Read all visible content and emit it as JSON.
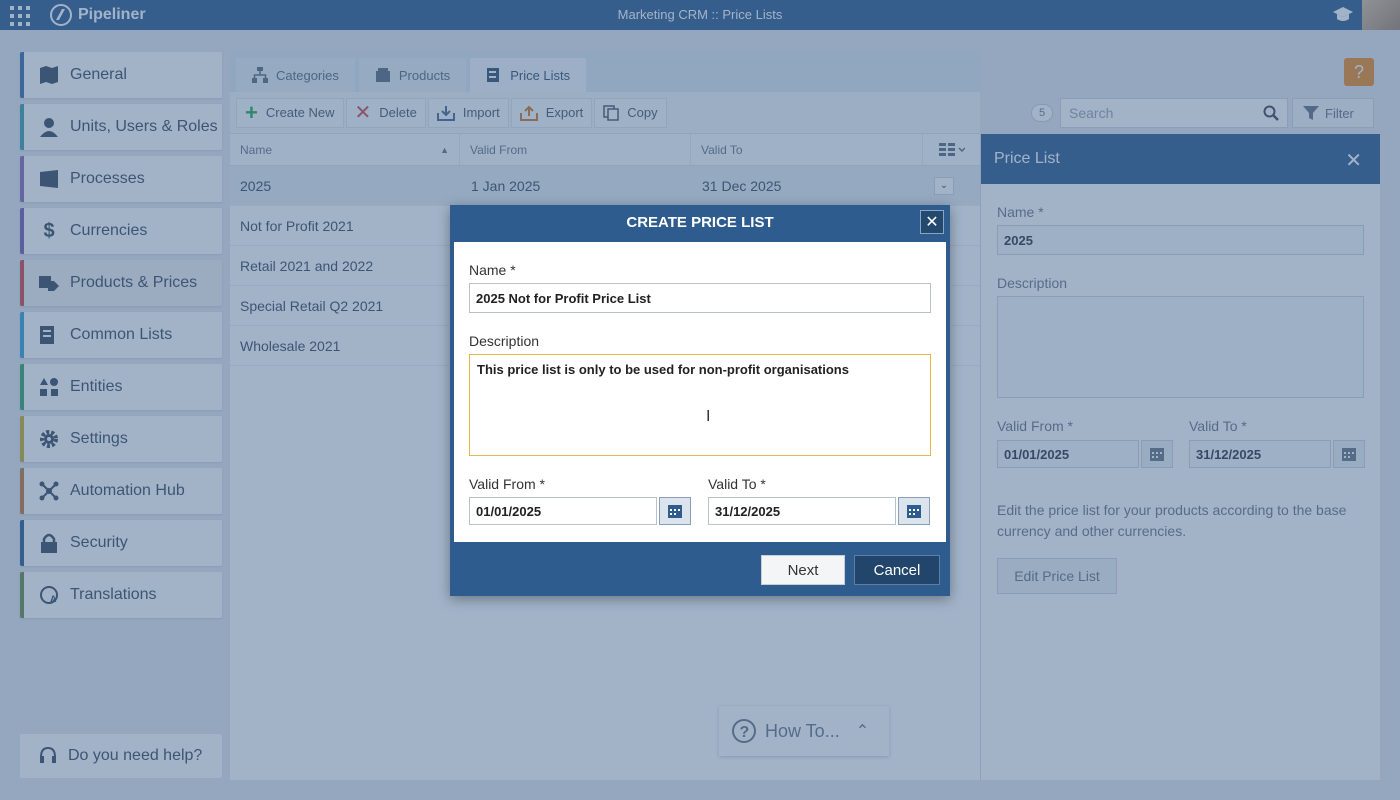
{
  "app": {
    "name": "Pipeliner",
    "window_title": "Marketing CRM :: Price Lists"
  },
  "nav": {
    "items": [
      {
        "label": "General",
        "color": "#3a6ea8"
      },
      {
        "label": "Units, Users & Roles",
        "color": "#40a0b0"
      },
      {
        "label": "Processes",
        "color": "#8a6bb5"
      },
      {
        "label": "Currencies",
        "color": "#7c5cb5"
      },
      {
        "label": "Products & Prices",
        "color": "#d2474a"
      },
      {
        "label": "Common Lists",
        "color": "#3aa2d8"
      },
      {
        "label": "Entities",
        "color": "#37a46a"
      },
      {
        "label": "Settings",
        "color": "#c8b02a"
      },
      {
        "label": "Automation Hub",
        "color": "#c47a39"
      },
      {
        "label": "Security",
        "color": "#2d5d94"
      },
      {
        "label": "Translations",
        "color": "#6b8c4b"
      }
    ],
    "help_label": "Do you need help?"
  },
  "tabs": [
    {
      "label": "Categories"
    },
    {
      "label": "Products"
    },
    {
      "label": "Price Lists"
    }
  ],
  "toolbar": {
    "create": "Create New",
    "delete": "Delete",
    "import": "Import",
    "export": "Export",
    "copy": "Copy",
    "count": "5",
    "search_placeholder": "Search",
    "filter": "Filter"
  },
  "grid": {
    "columns": [
      "Name",
      "Valid From",
      "Valid To"
    ],
    "rows": [
      {
        "name": "2025",
        "from": "1 Jan 2025",
        "to": "31 Dec 2025"
      },
      {
        "name": "Not for Profit 2021",
        "from": "",
        "to": ""
      },
      {
        "name": "Retail 2021 and 2022",
        "from": "",
        "to": ""
      },
      {
        "name": "Special Retail Q2 2021",
        "from": "",
        "to": ""
      },
      {
        "name": "Wholesale 2021",
        "from": "",
        "to": ""
      }
    ]
  },
  "side_panel": {
    "title": "Price List",
    "name_label": "Name *",
    "name_value": "2025",
    "description_label": "Description",
    "valid_from_label": "Valid From *",
    "valid_from_value": "01/01/2025",
    "valid_to_label": "Valid To *",
    "valid_to_value": "31/12/2025",
    "info_text": "Edit the price list for your products according to the base currency and other currencies.",
    "edit_button": "Edit Price List"
  },
  "howto": {
    "label": "How To..."
  },
  "dialog": {
    "title": "CREATE PRICE LIST",
    "name_label": "Name *",
    "name_value": "2025 Not for Profit Price List",
    "description_label": "Description",
    "description_value": "This price list is only to be used for non-profit organisations",
    "valid_from_label": "Valid From *",
    "valid_from_value": "01/01/2025",
    "valid_to_label": "Valid To *",
    "valid_to_value": "31/12/2025",
    "next_button": "Next",
    "cancel_button": "Cancel"
  }
}
